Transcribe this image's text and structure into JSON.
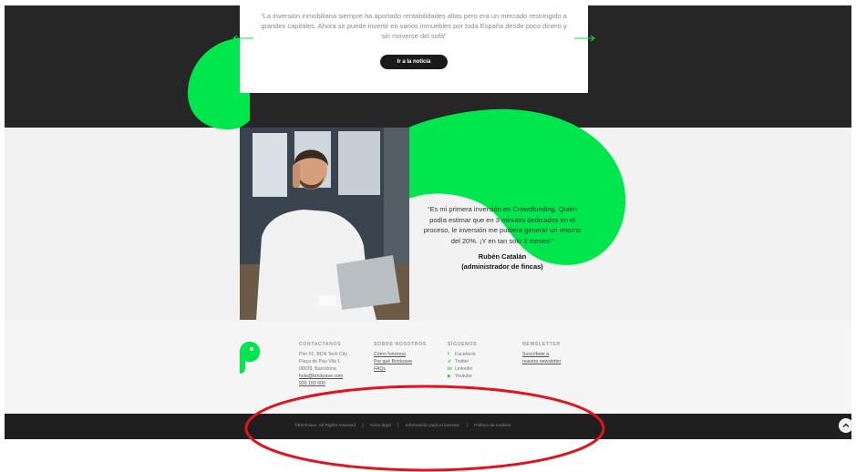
{
  "colors": {
    "accent": "#00e64d",
    "dark": "#262626",
    "footer_dark": "#1f1f1f",
    "annotation": "#e0141e"
  },
  "hero": {
    "quote": "“La inversión inmobiliaria siempre ha aportado rentabilidades altas pero era un mercado restringido a grandes capitales. Ahora se puede invertir en varios inmuebles por toda España desde poco dinero y sin moverse del sofá”",
    "button": "Ir a la noticia"
  },
  "testimonial": {
    "quote": "“Es mi primera inversión en Crowdfunding. Quién podía estimar que en 3 minutos dedicados en el proceso, le inversión me pudiera generar un retorno del 20%. ¡Y en tan solo 3 meses!”",
    "author": "Rubén Catalán",
    "role": "(administrador de fincas)"
  },
  "footer": {
    "contact": {
      "heading": "CONTACTANOS",
      "lines": [
        "Pier 01, BCN Tech City",
        "Plaça de Pau Vila 1",
        "08039, Barcelona"
      ],
      "email": "hola@bricksave.com",
      "phone": "930 183 600"
    },
    "about": {
      "heading": "SOBRE NOSOTROS",
      "links": [
        "Cómo funciona",
        "Por qué Bricksave",
        "FAQs"
      ]
    },
    "social": {
      "heading": "SÍGUENOS",
      "items": [
        {
          "icon": "facebook-icon",
          "glyph": "f",
          "label": "Facebook"
        },
        {
          "icon": "twitter-icon",
          "glyph": "✔",
          "label": "Twitter"
        },
        {
          "icon": "linkedin-icon",
          "glyph": "in",
          "label": "Linkedin"
        },
        {
          "icon": "youtube-icon",
          "glyph": "▶",
          "label": "Youtube"
        }
      ]
    },
    "newsletter": {
      "heading": "NEWSLETTER",
      "links": [
        "Suscríbete a",
        "nuestra newsletter"
      ]
    }
  },
  "legal": {
    "copyright": "©Bricksave. All Rights reserved",
    "items": [
      "Aviso legal",
      "Información para el inversor",
      "Política de cookies"
    ]
  },
  "scroll_top_icon": "chevron-up-icon"
}
